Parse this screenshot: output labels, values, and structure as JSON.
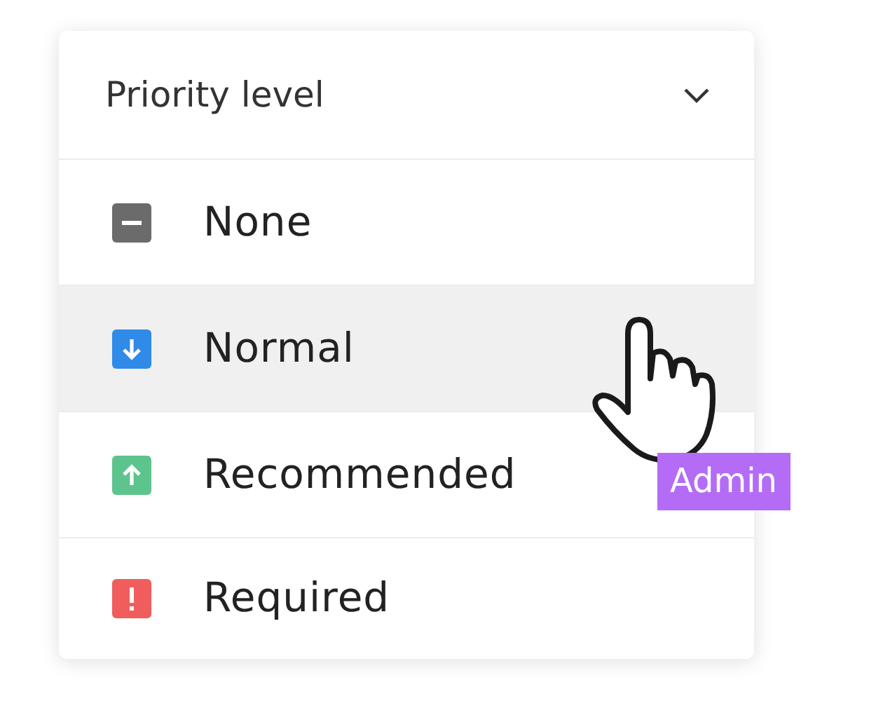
{
  "dropdown": {
    "title": "Priority level",
    "expanded": true
  },
  "options": [
    {
      "label": "None",
      "kind": "none",
      "color": "#6b6b6b",
      "selected": false
    },
    {
      "label": "Normal",
      "kind": "down",
      "color": "#2f8ae8",
      "selected": true
    },
    {
      "label": "Recommended",
      "kind": "up",
      "color": "#5cc48c",
      "selected": false
    },
    {
      "label": "Required",
      "kind": "alert",
      "color": "#ef5d5d",
      "selected": false
    }
  ],
  "cursor": {
    "label": "Admin"
  }
}
